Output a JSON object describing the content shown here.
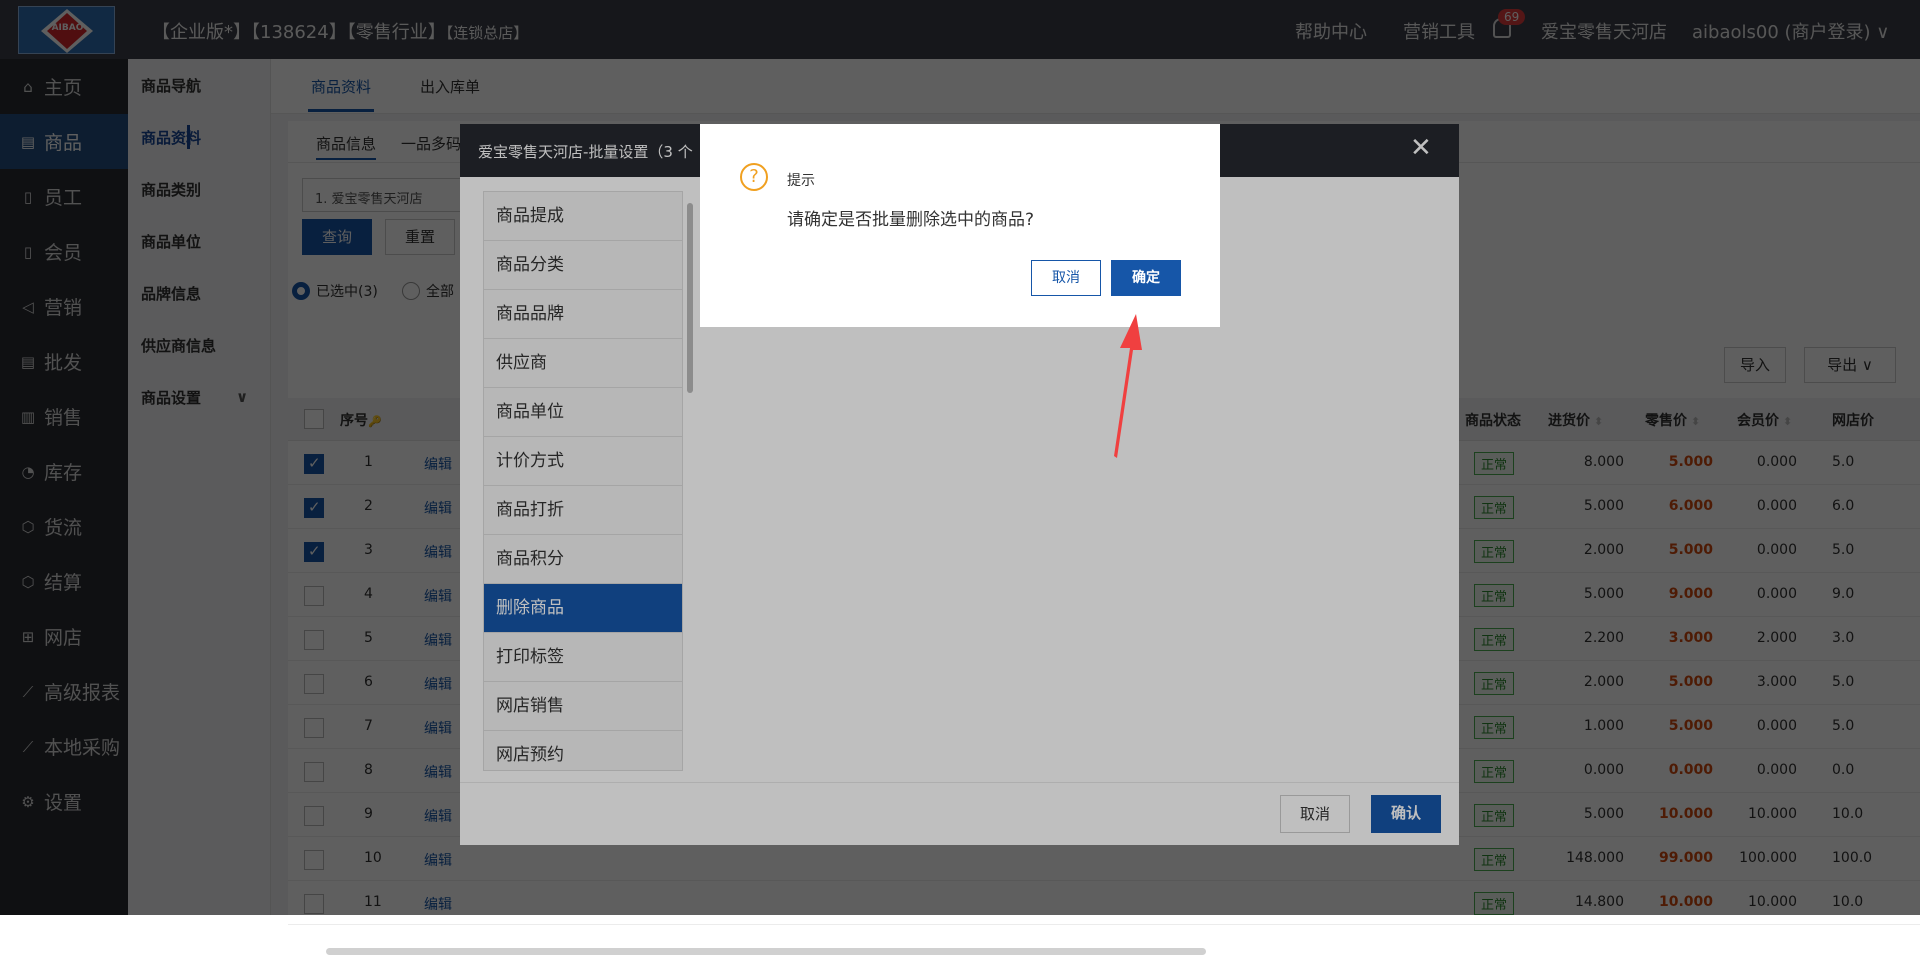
{
  "header": {
    "logo_text": "AIBAO",
    "corp_info": "【企业版*】【138624】【零售行业】",
    "corp_tag": "【连锁总店】",
    "nav": [
      "帮助中心",
      "营销工具"
    ],
    "badge": "69",
    "store": "爱宝零售天河店",
    "user": "aibaols00 (商户登录)",
    "user_chevron": "∨"
  },
  "sidebar": {
    "items": [
      {
        "icon": "⌂",
        "label": "主页"
      },
      {
        "icon": "▤",
        "label": "商品"
      },
      {
        "icon": "▯",
        "label": "员工"
      },
      {
        "icon": "▯",
        "label": "会员"
      },
      {
        "icon": "◁",
        "label": "营销"
      },
      {
        "icon": "▤",
        "label": "批发"
      },
      {
        "icon": "▥",
        "label": "销售"
      },
      {
        "icon": "◔",
        "label": "库存"
      },
      {
        "icon": "⬡",
        "label": "货流"
      },
      {
        "icon": "⬡",
        "label": "结算"
      },
      {
        "icon": "⊞",
        "label": "网店"
      },
      {
        "icon": "⟋",
        "label": "高级报表"
      },
      {
        "icon": "⟋",
        "label": "本地采购"
      },
      {
        "icon": "⚙",
        "label": "设置"
      }
    ]
  },
  "subnav": {
    "items": [
      "商品导航",
      "商品资料",
      "商品类别",
      "商品单位",
      "品牌信息",
      "供应商信息",
      "商品设置"
    ],
    "chevron": "∨"
  },
  "tabs1": [
    "商品资料",
    "出入库单"
  ],
  "tabs2": [
    "商品信息",
    "一品多码"
  ],
  "filter": {
    "store": "1. 爱宝零售天河店",
    "query": "查询",
    "reset": "重置"
  },
  "radios": [
    "已选中(3)",
    "全部"
  ],
  "actions": {
    "import": "导入",
    "export": "导出",
    "export_chevron": "∨"
  },
  "table": {
    "headers": {
      "seq": "序号",
      "status": "商品状态",
      "purchase": "进货价",
      "retail": "零售价",
      "member": "会员价",
      "online": "网店价"
    },
    "sort_glyph": "⬍",
    "key_glyph": "🔑",
    "edit": "编辑",
    "rows": [
      {
        "n": "1",
        "checked": true,
        "status": "正常",
        "purchase": "8.000",
        "retail": "5.000",
        "member": "0.000",
        "online": "5.0"
      },
      {
        "n": "2",
        "checked": true,
        "status": "正常",
        "purchase": "5.000",
        "retail": "6.000",
        "member": "0.000",
        "online": "6.0"
      },
      {
        "n": "3",
        "checked": true,
        "status": "正常",
        "purchase": "2.000",
        "retail": "5.000",
        "member": "0.000",
        "online": "5.0"
      },
      {
        "n": "4",
        "checked": false,
        "status": "正常",
        "purchase": "5.000",
        "retail": "9.000",
        "member": "0.000",
        "online": "9.0"
      },
      {
        "n": "5",
        "checked": false,
        "status": "正常",
        "purchase": "2.200",
        "retail": "3.000",
        "member": "2.000",
        "online": "3.0"
      },
      {
        "n": "6",
        "checked": false,
        "status": "正常",
        "purchase": "2.000",
        "retail": "5.000",
        "member": "3.000",
        "online": "5.0"
      },
      {
        "n": "7",
        "checked": false,
        "status": "正常",
        "purchase": "1.000",
        "retail": "5.000",
        "member": "0.000",
        "online": "5.0"
      },
      {
        "n": "8",
        "checked": false,
        "status": "正常",
        "purchase": "0.000",
        "retail": "0.000",
        "member": "0.000",
        "online": "0.0"
      },
      {
        "n": "9",
        "checked": false,
        "status": "正常",
        "purchase": "5.000",
        "retail": "10.000",
        "member": "10.000",
        "online": "10.0"
      },
      {
        "n": "10",
        "checked": false,
        "status": "正常",
        "purchase": "148.000",
        "retail": "99.000",
        "member": "100.000",
        "online": "100.0"
      },
      {
        "n": "11",
        "checked": false,
        "status": "正常",
        "purchase": "14.800",
        "retail": "10.000",
        "member": "10.000",
        "online": "10.0"
      }
    ]
  },
  "batch_dialog": {
    "title": "爱宝零售天河店-批量设置（3 个",
    "close": "✕",
    "items": [
      "商品提成",
      "商品分类",
      "商品品牌",
      "供应商",
      "商品单位",
      "计价方式",
      "商品打折",
      "商品积分",
      "删除商品",
      "打印标签",
      "网店销售",
      "网店预约"
    ],
    "active_index": 8,
    "cancel": "取消",
    "confirm": "确认"
  },
  "confirm_dialog": {
    "icon": "?",
    "title": "提示",
    "message": "请确定是否批量删除选中的商品?",
    "cancel": "取消",
    "ok": "确定"
  }
}
